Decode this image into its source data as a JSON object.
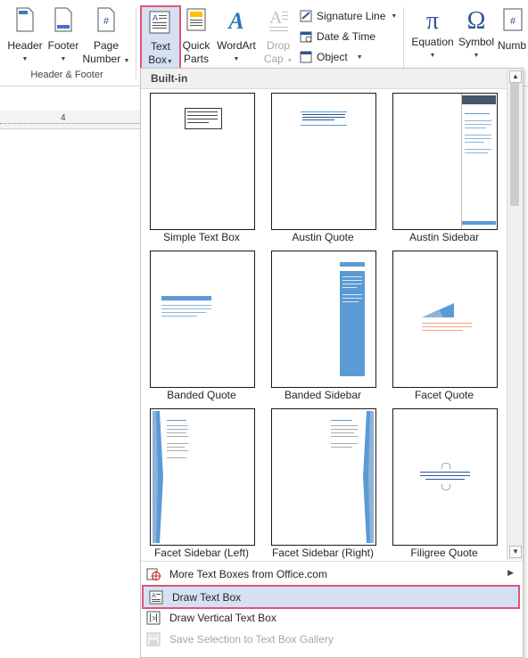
{
  "ribbon": {
    "header_label": "Header",
    "footer_label": "Footer",
    "page_label": "Page",
    "number_label": "Number",
    "textbox_label1": "Text",
    "textbox_label2": "Box",
    "quick_label1": "Quick",
    "quick_label2": "Parts",
    "wordart_label": "WordArt",
    "dropcap_label1": "Drop",
    "dropcap_label2": "Cap",
    "signature_label": "Signature Line",
    "datetime_label": "Date & Time",
    "object_label": "Object",
    "equation_label": "Equation",
    "symbol_label": "Symbol",
    "number_cut_label": "Numb",
    "group_header_footer": "Header & Footer",
    "ruler_mark": "4"
  },
  "gallery": {
    "section_title": "Built-in",
    "items": [
      {
        "label": "Simple Text Box"
      },
      {
        "label": "Austin Quote"
      },
      {
        "label": "Austin Sidebar"
      },
      {
        "label": "Banded Quote"
      },
      {
        "label": "Banded Sidebar"
      },
      {
        "label": "Facet Quote"
      },
      {
        "label": "Facet Sidebar (Left)"
      },
      {
        "label": "Facet Sidebar (Right)"
      },
      {
        "label": "Filigree Quote"
      }
    ]
  },
  "menu": {
    "more": "More Text Boxes from Office.com",
    "draw": "Draw Text Box",
    "draw_vertical": "Draw Vertical Text Box",
    "save_selection": "Save Selection to Text Box Gallery"
  },
  "colors": {
    "highlight_border": "#e0547c",
    "highlight_fill": "#d5e1f2",
    "accent_blue": "#2b579a",
    "thumb_blue": "#5b9bd5",
    "facet_orange": "#f4a582"
  }
}
